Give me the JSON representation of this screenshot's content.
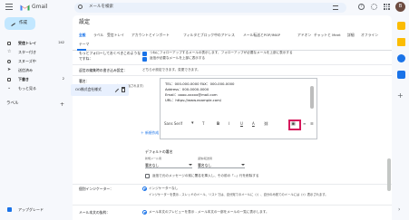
{
  "header": {
    "app_title": "Gmail",
    "search_placeholder": "メールを検索",
    "avatar_initial": "B",
    "help_glyph": "?"
  },
  "nav": {
    "compose": "作成",
    "items": [
      {
        "label": "受信トレイ",
        "count": "242"
      },
      {
        "label": "スター付き",
        "count": ""
      },
      {
        "label": "スヌーズ中",
        "count": ""
      },
      {
        "label": "送信済み",
        "count": ""
      },
      {
        "label": "下書き",
        "count": "2"
      },
      {
        "label": "もっと見る",
        "count": ""
      }
    ],
    "labels_heading": "ラベル",
    "labels_add": "+",
    "upgrade": "アップグレード"
  },
  "settings": {
    "title": "設定",
    "tabs_row1": [
      "全般",
      "ラベル",
      "受信トレイ",
      "アカウントとインポート",
      "フィルタとブロック中のアドレス",
      "メール転送とPOP/IMAP",
      "アドオン",
      "チャットと Meet",
      "詳細",
      "オフライン"
    ],
    "tabs_row2": [
      "テーマ"
    ],
    "rows": {
      "r1_label_a": "もっとフォローしておくべきこのような",
      "r1_label_b": "ですね：",
      "r1_text_a": "つねにフォローアップするメールの表示します、フォローアップが必要なメールを上部に表示する",
      "r1_text_b": "返信が必要なメールを上部に表示する",
      "r2_label": "返信の編集時の書き込み設定：",
      "r2_text": "どちらか設定できます。変更できます。",
      "sig_label": "署名：",
      "sig_desc_a": "(送信するすべてのメールの末尾に追加されます)",
      "sig_desc_link": "詳細を表示"
    },
    "signature": {
      "name": "OO株式会社様式",
      "lines": [
        "TEL：000-000-0000  FAX：000-000-0000",
        "Address：000-0000-0000",
        "Email：oooo-xxxxx@mail.com",
        "URL：https://www.example.com/"
      ],
      "toolbar": {
        "font": "Sans Serif",
        "size": "T",
        "bold": "B",
        "italic": "I",
        "underline": "U",
        "color": "A",
        "link": "⛓",
        "image": "▣",
        "align": "≡",
        "list": "☰"
      },
      "add_new": "＋ 新規作成"
    },
    "defaults": {
      "title": "デフォルトの署名",
      "new_label": "新規メール用",
      "new_value": "署名なし",
      "reply_label": "返信/転送用",
      "reply_value": "署名なし",
      "insert_text": "返信で元のメッセージの前に署名を挿入し、その前の「--」行を削除する"
    },
    "indicators": {
      "label": "個別インジケーター：",
      "option1": "インジケーターなし",
      "desc": "インジケーターを表示 - スレッドのメール、リストでは、自分宛てのメールに（›）、自分のみ宛てのメールには（»）表示されます。"
    },
    "snippets": {
      "label": "メール本文の抜粋：",
      "option1": "メール本文のプレビューを表示 - メール本文の一部をメールの一覧に表示します。"
    }
  },
  "colors": {
    "accent": "#1a73e8",
    "highlight": "#d6195c",
    "compose_bg": "#c2e7ff"
  }
}
